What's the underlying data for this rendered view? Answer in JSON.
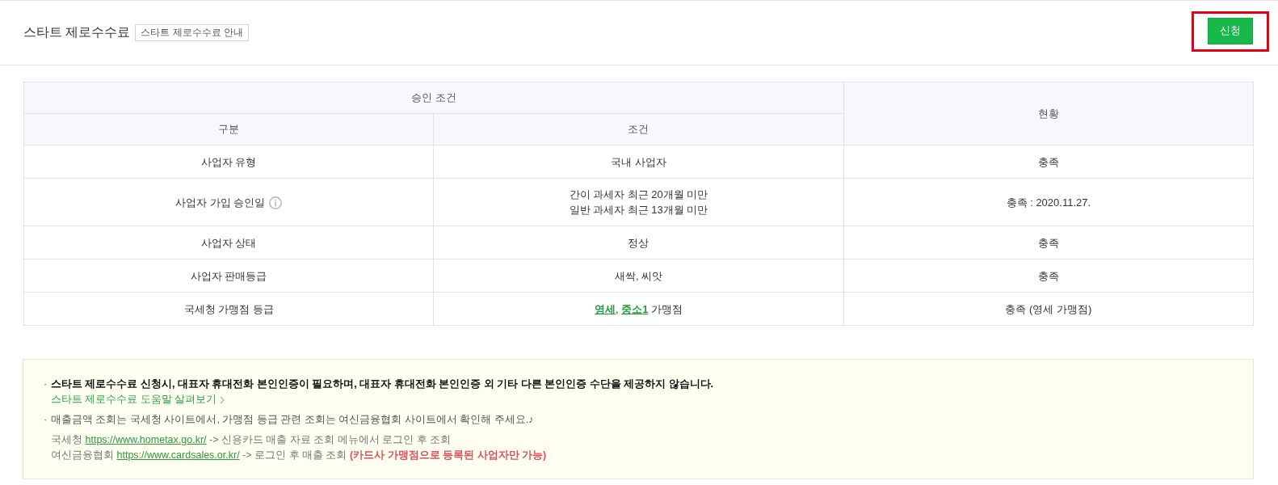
{
  "header": {
    "title": "스타트 제로수수료",
    "guide": "스타트 제로수수료 안내",
    "highlighted": true,
    "apply_button": "신청"
  },
  "table": {
    "group_header": "승인 조건",
    "columns": [
      "구분",
      "조건"
    ],
    "status_header": "현황",
    "rows": [
      {
        "label": "사업자 유형",
        "has_info": false,
        "condition": [
          [
            {
              "text": "국내 사업자",
              "kind": "plain"
            }
          ]
        ],
        "status": "충족"
      },
      {
        "label": "사업자 가입 승인일",
        "has_info": true,
        "condition": [
          [
            {
              "text": "간이 과세자 최근 20개월 미만",
              "kind": "plain"
            }
          ],
          [
            {
              "text": "일반 과세자 최근 13개월 미만",
              "kind": "plain"
            }
          ]
        ],
        "status": "충족 : 2020.11.27."
      },
      {
        "label": "사업자 상태",
        "has_info": false,
        "condition": [
          [
            {
              "text": "정상",
              "kind": "plain"
            }
          ]
        ],
        "status": "충족"
      },
      {
        "label": "사업자 판매등급",
        "has_info": false,
        "condition": [
          [
            {
              "text": "새싹, 씨앗",
              "kind": "plain"
            }
          ]
        ],
        "status": "충족"
      },
      {
        "label": "국세청 가맹점 등급",
        "has_info": false,
        "condition": [
          [
            {
              "text": "영세",
              "kind": "link",
              "after": ", "
            },
            {
              "text": "중소1",
              "kind": "link"
            },
            {
              "text": " 가맹점",
              "kind": "plain"
            }
          ]
        ],
        "status": "충족 (영세 가맹점)"
      }
    ]
  },
  "notice": {
    "items": [
      {
        "bullet": "·",
        "kind": "strong",
        "text": "스타트 제로수수료 신청시, 대표자 휴대전화 본인인증이 필요하며, 대표자 휴대전화 본인인증 외 기타 다른 본인인증 수단을 제공하지 않습니다.",
        "help_link": "스타트 제로수수료 도움말 살펴보기"
      },
      {
        "bullet": "·",
        "kind": "plain",
        "text": "매출금액 조회는 국세청 사이트에서, 가맹점 등급 관련 조회는 여신금융협회 사이트에서 확인해 주세요.♪",
        "details": [
          [
            {
              "text": "국세청 ",
              "kind": "plain"
            },
            {
              "text": "https://www.hometax.go.kr/",
              "kind": "url"
            },
            {
              "text": " -> 신용카드 매출 자료 조회 메뉴에서 로그인 후 조회",
              "kind": "plain"
            }
          ],
          [
            {
              "text": "여신금융협회 ",
              "kind": "plain"
            },
            {
              "text": "https://www.cardsales.or.kr/",
              "kind": "url"
            },
            {
              "text": " -> 로그인 후 매출 조회 ",
              "kind": "plain"
            },
            {
              "text": "(카드사 가맹점으로 등록된 사업자만 가능)",
              "kind": "warning"
            }
          ]
        ]
      }
    ]
  }
}
